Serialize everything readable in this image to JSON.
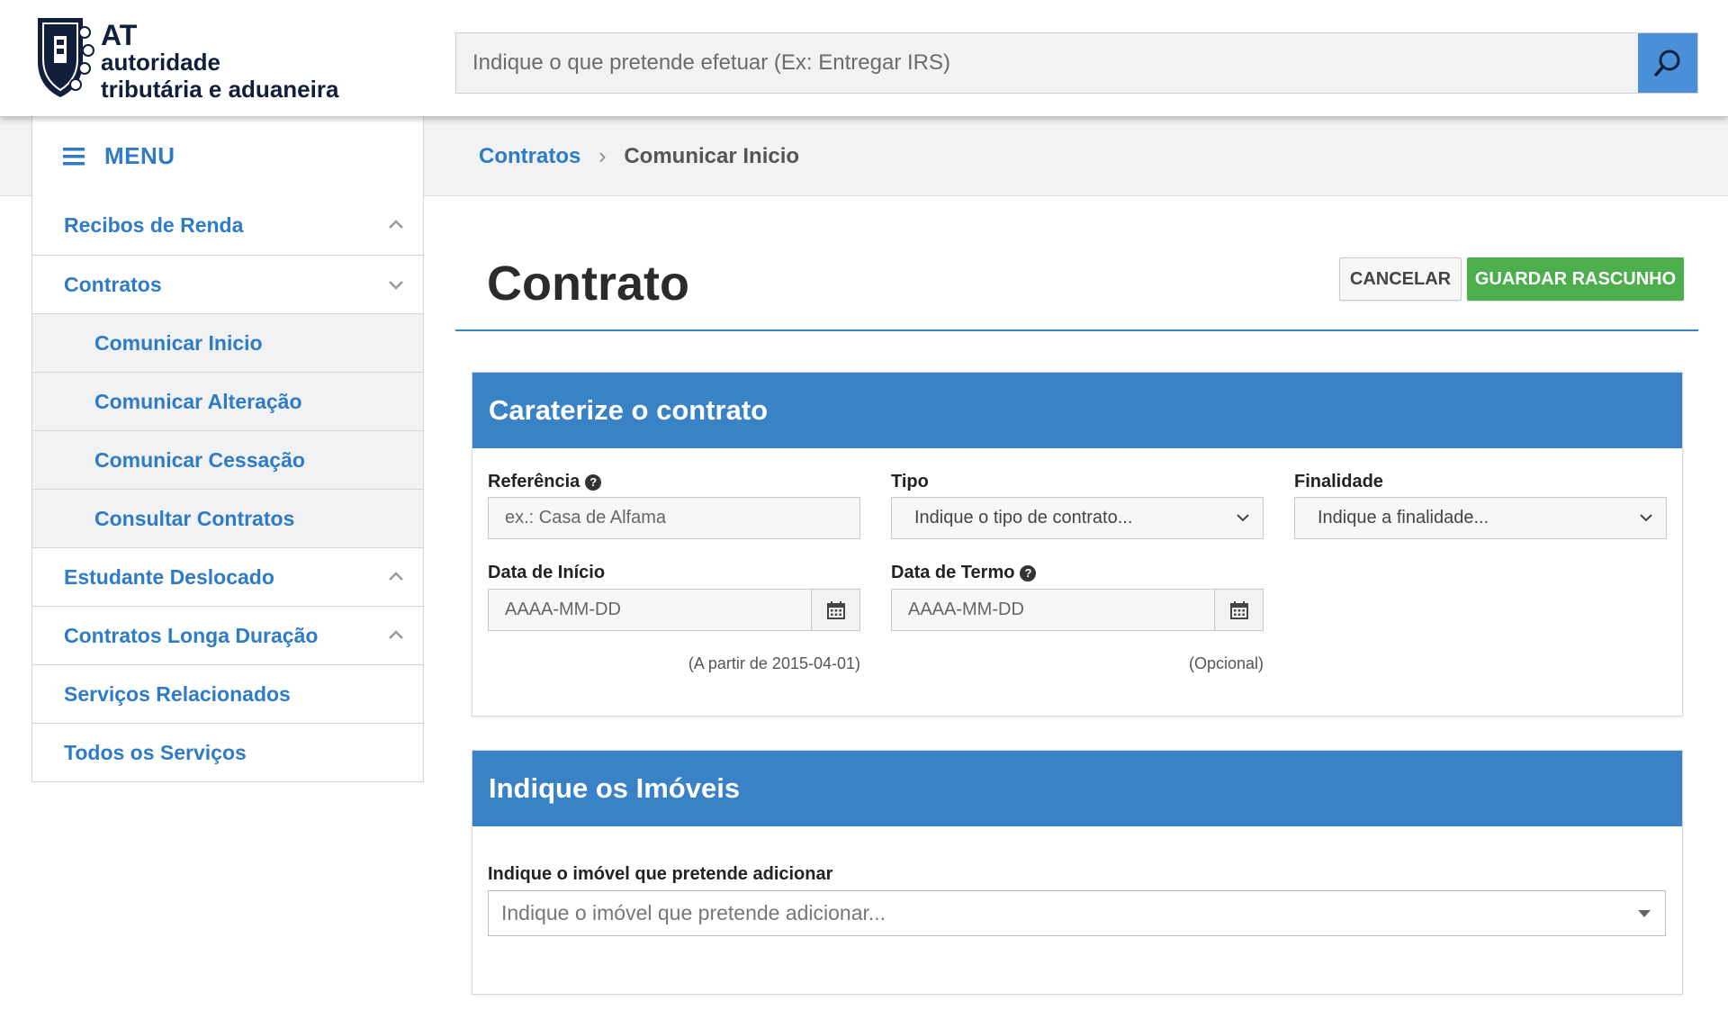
{
  "header": {
    "logo": {
      "abbr": "AT",
      "line1": "autoridade",
      "line2": "tributária e aduaneira"
    },
    "search": {
      "placeholder": "Indique o que pretende efetuar (Ex: Entregar IRS)"
    },
    "search_icon": "search-icon"
  },
  "menu": {
    "label": "MENU",
    "icon": "hamburger-icon"
  },
  "breadcrumb": {
    "parent": "Contratos",
    "separator": "›",
    "current": "Comunicar Inicio"
  },
  "sidebar": {
    "items": [
      {
        "label": "Recibos de Renda",
        "chevron": "up"
      },
      {
        "label": "Contratos",
        "chevron": "down"
      },
      {
        "label": "Comunicar Inicio",
        "sub": true
      },
      {
        "label": "Comunicar Alteração",
        "sub": true
      },
      {
        "label": "Comunicar Cessação",
        "sub": true
      },
      {
        "label": "Consultar Contratos",
        "sub": true
      },
      {
        "label": "Estudante Deslocado",
        "chevron": "up"
      },
      {
        "label": "Contratos Longa Duração",
        "chevron": "up"
      },
      {
        "label": "Serviços Relacionados"
      },
      {
        "label": "Todos os Serviços"
      }
    ]
  },
  "main": {
    "title": "Contrato",
    "cancel_label": "CANCELAR",
    "save_label": "GUARDAR RASCUNHO",
    "colors": {
      "accent": "#3a82c6",
      "save": "#4cae4c",
      "link": "#2f7bc4"
    }
  },
  "contract_panel": {
    "heading": "Caraterize o contrato",
    "referencia": {
      "label": "Referência",
      "placeholder": "ex.: Casa de Alfama"
    },
    "tipo": {
      "label": "Tipo",
      "value": "Indique o tipo de contrato..."
    },
    "finalidade": {
      "label": "Finalidade",
      "value": "Indique a finalidade..."
    },
    "data_inicio": {
      "label": "Data de Início",
      "placeholder": "AAAA-MM-DD",
      "hint": "(A partir de 2015-04-01)"
    },
    "data_termo": {
      "label": "Data de Termo",
      "placeholder": "AAAA-MM-DD",
      "hint": "(Opcional)"
    }
  },
  "property_panel": {
    "heading": "Indique os Imóveis",
    "label": "Indique o imóvel que pretende adicionar",
    "select_placeholder": "Indique o imóvel que pretende adicionar..."
  }
}
